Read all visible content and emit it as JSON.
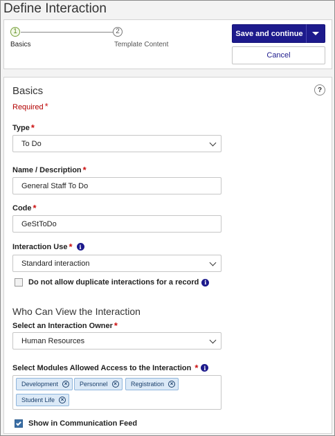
{
  "page": {
    "title": "Define Interaction"
  },
  "stepper": {
    "steps": [
      {
        "number": "1",
        "label": "Basics"
      },
      {
        "number": "2",
        "label": "Template Content"
      }
    ]
  },
  "actions": {
    "save_label": "Save and continue",
    "cancel_label": "Cancel"
  },
  "basics": {
    "title": "Basics",
    "required_label": "Required",
    "required_marker": "*",
    "help_glyph": "?",
    "type": {
      "label": "Type",
      "value": "To Do"
    },
    "name": {
      "label": "Name / Description",
      "value": "General Staff To Do"
    },
    "code": {
      "label": "Code",
      "value": "GeStToDo"
    },
    "interaction_use": {
      "label": "Interaction Use",
      "value": "Standard interaction"
    },
    "no_duplicates": {
      "label": "Do not allow duplicate interactions for a record",
      "checked": false
    }
  },
  "visibility": {
    "title": "Who Can View the Interaction",
    "owner": {
      "label": "Select an Interaction Owner",
      "value": "Human Resources"
    },
    "modules": {
      "label": "Select Modules Allowed Access to the Interaction",
      "tags": [
        "Development",
        "Personnel",
        "Registration",
        "Student Life"
      ]
    },
    "show_in_feed": {
      "label": "Show in Communication Feed",
      "checked": true
    }
  },
  "icons": {
    "info": "info-icon",
    "remove": "remove-tag-icon",
    "dropdown": "chevron-down-icon"
  },
  "colors": {
    "primary": "#1d1a8c",
    "required": "#cc1111",
    "tag_bg": "#dbe9f7"
  }
}
